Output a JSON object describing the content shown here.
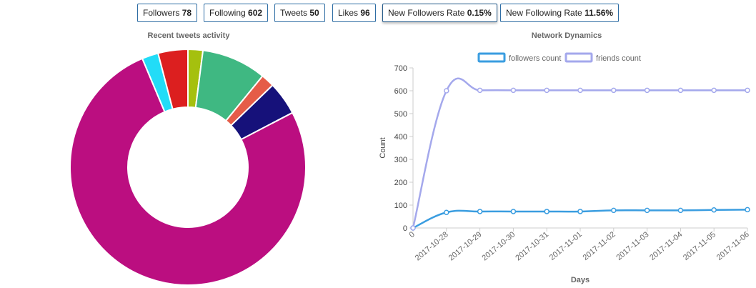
{
  "stats": [
    {
      "label": "Followers",
      "value": "78"
    },
    {
      "label": "Following",
      "value": "602"
    },
    {
      "label": "Tweets",
      "value": "50"
    },
    {
      "label": "Likes",
      "value": "96"
    },
    {
      "label": "New Followers Rate",
      "value": "0.15%"
    },
    {
      "label": "New Following Rate",
      "value": "11.56%"
    }
  ],
  "chart_data": [
    {
      "type": "pie",
      "title": "Recent tweets activity",
      "donut": true,
      "slices": [
        {
          "value": 2.0,
          "color": "#a5c00e"
        },
        {
          "value": 8.7,
          "color": "#3fb882"
        },
        {
          "value": 1.8,
          "color": "#e55c48"
        },
        {
          "value": 4.5,
          "color": "#16117a"
        },
        {
          "value": 74.8,
          "color": "#bb0e80"
        },
        {
          "value": 2.2,
          "color": "#22dcf7"
        },
        {
          "value": 4.0,
          "color": "#dc1f1f"
        }
      ]
    },
    {
      "type": "line",
      "title": "Network Dynamics",
      "xlabel": "Days",
      "ylabel": "Count",
      "categories": [
        "0",
        "2017-10-28",
        "2017-10-29",
        "2017-10-30",
        "2017-10-31",
        "2017-11-01",
        "2017-11-02",
        "2017-11-03",
        "2017-11-04",
        "2017-11-05",
        "2017-11-06"
      ],
      "ylim": [
        0,
        700
      ],
      "yticks": [
        0,
        100,
        200,
        300,
        400,
        500,
        600,
        700
      ],
      "legend_position": "top",
      "series": [
        {
          "name": "followers count",
          "color": "#3a9de0",
          "values": [
            0,
            68,
            72,
            72,
            72,
            72,
            77,
            77,
            77,
            79,
            80
          ]
        },
        {
          "name": "friends count",
          "color": "#a4a8ec",
          "values": [
            0,
            600,
            602,
            602,
            602,
            602,
            602,
            602,
            602,
            602,
            602
          ]
        }
      ]
    }
  ]
}
